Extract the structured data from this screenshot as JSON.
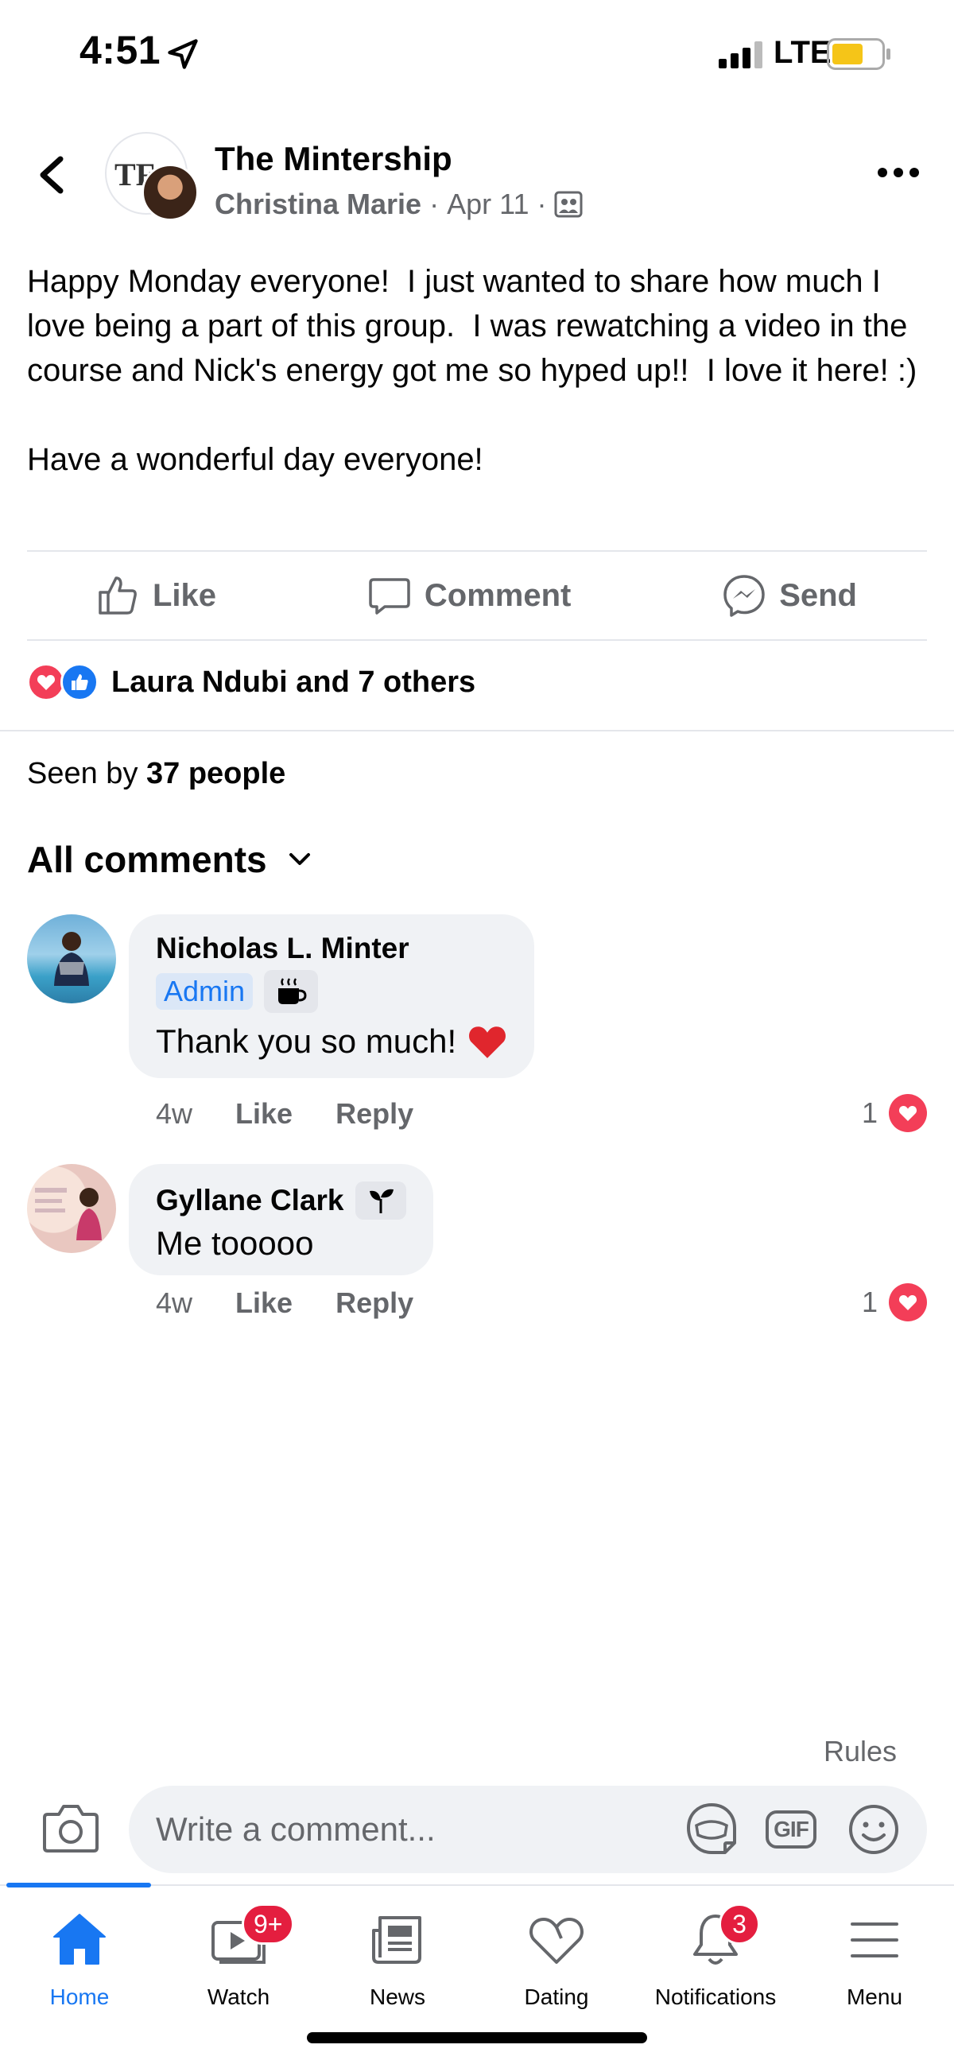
{
  "status_bar": {
    "time": "4:51",
    "network": "LTE"
  },
  "post": {
    "group_name": "The Mintership",
    "group_logo_text": "TF",
    "author": "Christina Marie",
    "date": "Apr 11",
    "separator": "·",
    "paragraphs": [
      "Happy Monday everyone!  I just wanted to share how much I love being a part of this group.  I was rewatching a video in the course and Nick's energy got me so hyped up!!  I love it here! :)",
      "Have a wonderful day everyone!"
    ],
    "actions": {
      "like": "Like",
      "comment": "Comment",
      "send": "Send"
    },
    "reactions_text": "Laura Ndubi and 7 others",
    "seen_by_prefix": "Seen by ",
    "seen_by_count": "37 people"
  },
  "comments_header": "All comments",
  "comments": [
    {
      "name": "Nicholas L. Minter",
      "badge": "Admin",
      "text": "Thank you so much!",
      "time": "4w",
      "like": "Like",
      "reply": "Reply",
      "reaction_count": "1"
    },
    {
      "name": "Gyllane Clark",
      "text": "Me tooooo",
      "time": "4w",
      "like": "Like",
      "reply": "Reply",
      "reaction_count": "1"
    }
  ],
  "composer": {
    "rules": "Rules",
    "placeholder": "Write a comment...",
    "gif": "GIF"
  },
  "bottom_nav": [
    {
      "label": "Home",
      "icon": "home-icon",
      "active": true
    },
    {
      "label": "Watch",
      "icon": "watch-icon",
      "badge": "9+"
    },
    {
      "label": "News",
      "icon": "news-icon"
    },
    {
      "label": "Dating",
      "icon": "dating-icon"
    },
    {
      "label": "Notifications",
      "icon": "bell-icon",
      "badge": "3"
    },
    {
      "label": "Menu",
      "icon": "menu-icon"
    }
  ],
  "colors": {
    "accent": "#1877f2",
    "love": "#f33e58",
    "badge": "#e41e3f",
    "secondary_text": "#65676b",
    "bubble": "#f0f2f5"
  }
}
